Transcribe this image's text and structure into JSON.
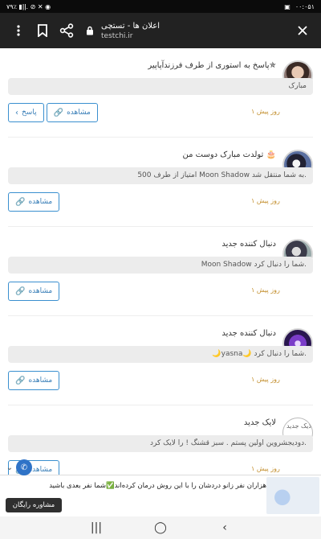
{
  "statusbar": {
    "time": "۰۰:۰۵۱",
    "battery": "۷۹٪",
    "indicators": "۷۹٪ ▮ǀǀ. ⊘ ✕ ◉"
  },
  "browser": {
    "title": "اعلان ها - تستچی",
    "url": "testchi.ir"
  },
  "notifications": [
    {
      "avatar": "a1",
      "title": "پاسخ به استوری از طرف فرزندآپاپیر✯",
      "body": "مبارک",
      "time": "۱ روز پیش",
      "actions": [
        {
          "label": "مشاهده",
          "icon": "link-icon"
        },
        {
          "label": "پاسخ",
          "icon": "chevron-left-icon"
        }
      ]
    },
    {
      "avatar": "a2",
      "title": "تولدت مبارک دوست من 🎂",
      "body": "500 امتیاز از طرف Moon Shadow به شما منتقل شد.",
      "time": "۱ روز پیش",
      "actions": [
        {
          "label": "مشاهده",
          "icon": "link-icon"
        }
      ]
    },
    {
      "avatar": "a3",
      "title": "دنبال کننده جدید",
      "body": "Moon Shadow شما را دنبال کرد.",
      "time": "۱ روز پیش",
      "actions": [
        {
          "label": "مشاهده",
          "icon": "link-icon"
        }
      ]
    },
    {
      "avatar": "a4",
      "title": "دنبال کننده جدید",
      "body": "🌙yasna🌙 شما را دنبال کرد.",
      "time": "۱ روز پیش",
      "actions": [
        {
          "label": "مشاهده",
          "icon": "link-icon"
        }
      ]
    },
    {
      "avatar": "a5",
      "avatar_alt": "لایک جدید",
      "title": "لایک جدید",
      "body": "دودیجشروین اولین پستم . سبز قشنگ ! را لایک کرد.",
      "time": "۱ روز پیش",
      "actions": [
        {
          "label": "مشاهده",
          "icon": "link-icon"
        }
      ]
    }
  ],
  "ad": {
    "text": "هزاران نفر زانو دردشان را با این روش درمان کرده‌اند✅شما نفر بعدی باشید",
    "cta": "مشاوره رایگان"
  },
  "nav": {
    "recents": "|||",
    "home": "◯",
    "back": "‹"
  }
}
